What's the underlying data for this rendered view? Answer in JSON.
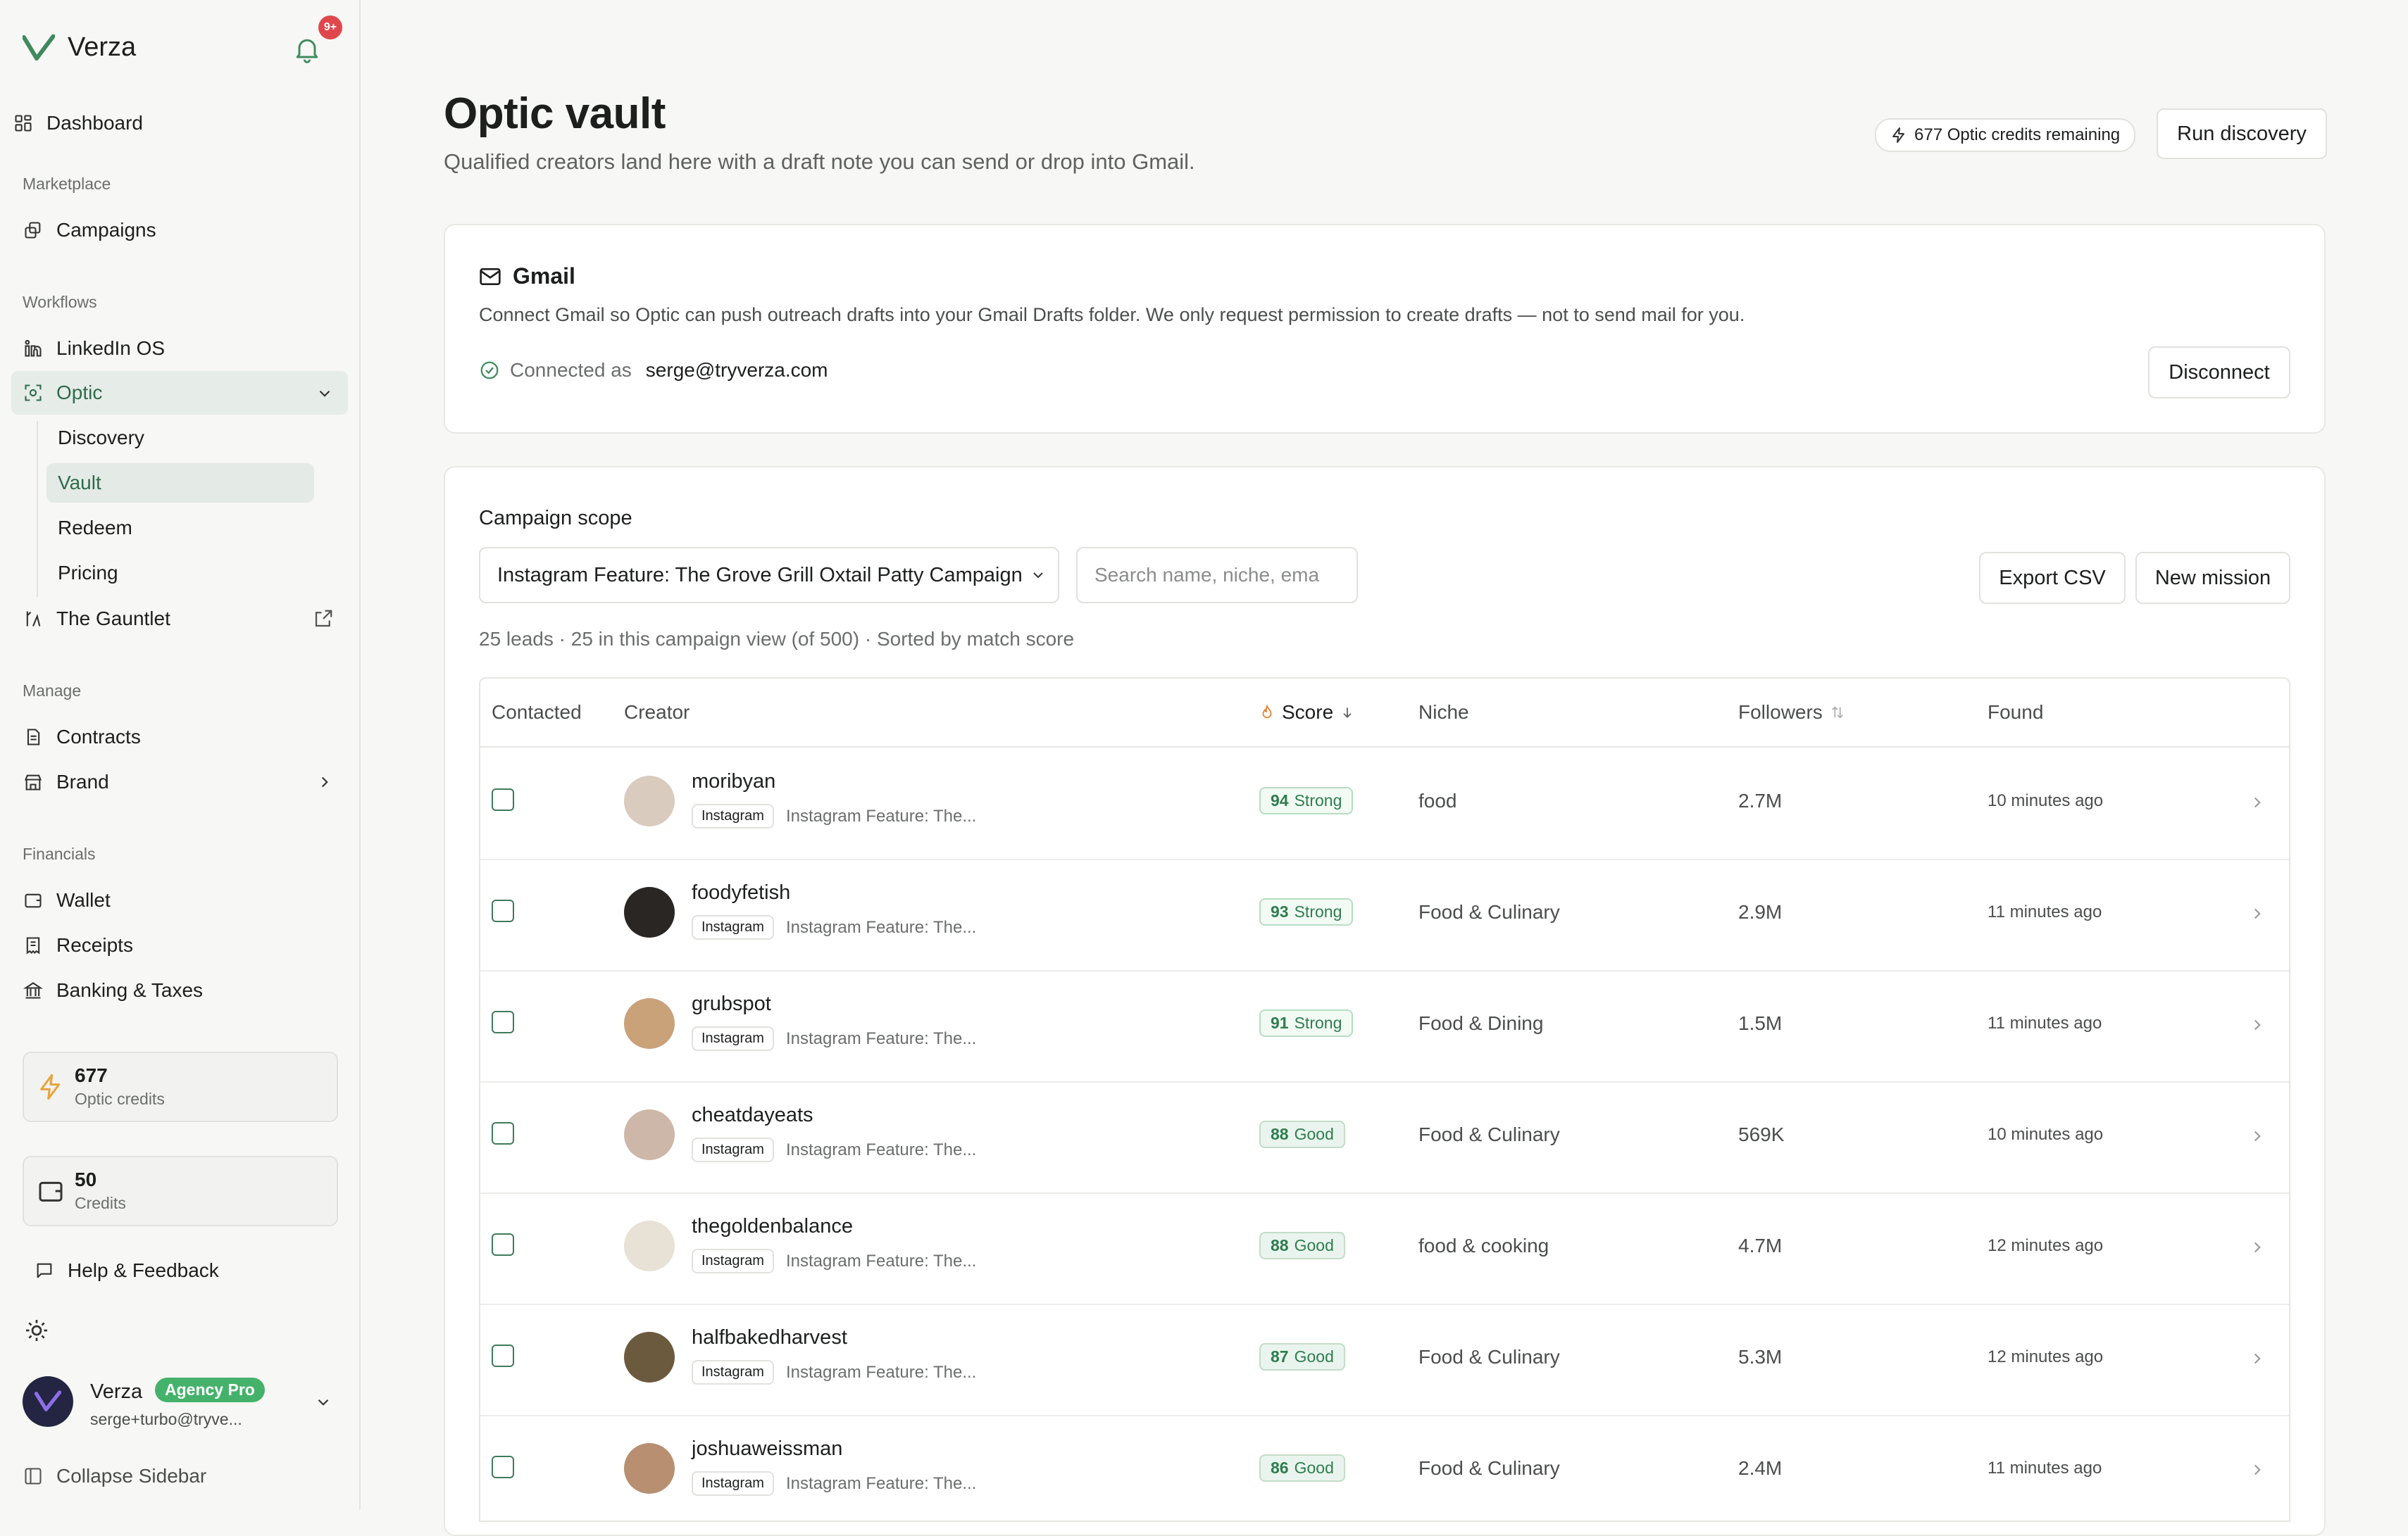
{
  "sidebar": {
    "brand": "Verza",
    "notification_badge": "9+",
    "dashboard": "Dashboard",
    "marketplace_label": "Marketplace",
    "campaigns": "Campaigns",
    "workflows_label": "Workflows",
    "linkedin": "LinkedIn OS",
    "optic": "Optic",
    "discovery": "Discovery",
    "vault": "Vault",
    "redeem": "Redeem",
    "pricing": "Pricing",
    "gauntlet": "The Gauntlet",
    "manage_label": "Manage",
    "contracts": "Contracts",
    "brand_item": "Brand",
    "financials_label": "Financials",
    "wallet": "Wallet",
    "receipts": "Receipts",
    "banking": "Banking & Taxes",
    "optic_credits_value": "677",
    "optic_credits_label": "Optic credits",
    "credits_value": "50",
    "credits_label": "Credits",
    "help": "Help & Feedback",
    "user_name": "Verza",
    "user_plan": "Agency Pro",
    "user_email": "serge+turbo@tryve...",
    "collapse": "Collapse Sidebar"
  },
  "header": {
    "title": "Optic vault",
    "subtitle": "Qualified creators land here with a draft note you can send or drop into Gmail.",
    "credits_remaining": "677 Optic credits remaining",
    "run_discovery": "Run discovery"
  },
  "gmail": {
    "title": "Gmail",
    "description": "Connect Gmail so Optic can push outreach drafts into your Gmail Drafts folder. We only request permission to create drafts — not to send mail for you.",
    "connected_as_label": "Connected as",
    "connected_email": "serge@tryverza.com",
    "disconnect": "Disconnect"
  },
  "scope": {
    "label": "Campaign scope",
    "selected_campaign": "Instagram Feature: The Grove Grill Oxtail Patty Campaign",
    "search_placeholder": "Search name, niche, ema",
    "export_csv": "Export CSV",
    "new_mission": "New mission",
    "leads_info": "25 leads · 25 in this campaign view (of 500) · Sorted by match score"
  },
  "table": {
    "headers": {
      "contacted": "Contacted",
      "creator": "Creator",
      "score": "Score",
      "niche": "Niche",
      "followers": "Followers",
      "found": "Found"
    },
    "rows": [
      {
        "handle": "moribyan",
        "platform": "Instagram",
        "campaign": "Instagram Feature: The...",
        "score": "94",
        "rating": "Strong",
        "niche": "food",
        "followers": "2.7M",
        "found": "10 minutes ago"
      },
      {
        "handle": "foodyfetish",
        "platform": "Instagram",
        "campaign": "Instagram Feature: The...",
        "score": "93",
        "rating": "Strong",
        "niche": "Food & Culinary",
        "followers": "2.9M",
        "found": "11 minutes ago"
      },
      {
        "handle": "grubspot",
        "platform": "Instagram",
        "campaign": "Instagram Feature: The...",
        "score": "91",
        "rating": "Strong",
        "niche": "Food & Dining",
        "followers": "1.5M",
        "found": "11 minutes ago"
      },
      {
        "handle": "cheatdayeats",
        "platform": "Instagram",
        "campaign": "Instagram Feature: The...",
        "score": "88",
        "rating": "Good",
        "niche": "Food & Culinary",
        "followers": "569K",
        "found": "10 minutes ago"
      },
      {
        "handle": "thegoldenbalance",
        "platform": "Instagram",
        "campaign": "Instagram Feature: The...",
        "score": "88",
        "rating": "Good",
        "niche": "food & cooking",
        "followers": "4.7M",
        "found": "12 minutes ago"
      },
      {
        "handle": "halfbakedharvest",
        "platform": "Instagram",
        "campaign": "Instagram Feature: The...",
        "score": "87",
        "rating": "Good",
        "niche": "Food & Culinary",
        "followers": "5.3M",
        "found": "12 minutes ago"
      },
      {
        "handle": "joshuaweissman",
        "platform": "Instagram",
        "campaign": "Instagram Feature: The...",
        "score": "86",
        "rating": "Good",
        "niche": "Food & Culinary",
        "followers": "2.4M",
        "found": "11 minutes ago"
      }
    ]
  },
  "colors": {
    "accent_green": "#2e7d4f",
    "badge_red": "#e0474c",
    "pro_green": "#45b26b",
    "flame_orange": "#e8863a"
  }
}
